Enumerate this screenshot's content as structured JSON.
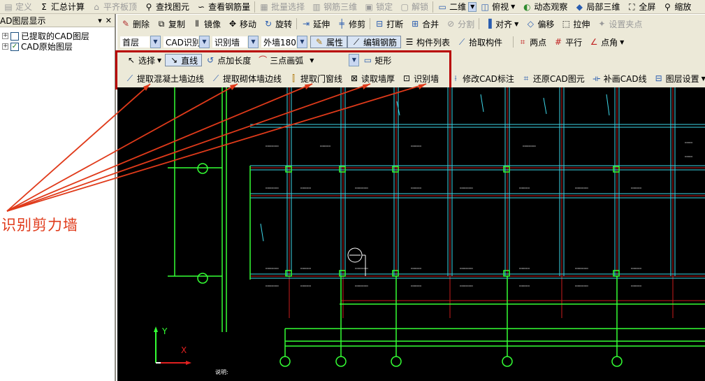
{
  "menubar": {
    "items": [
      {
        "label": "定义",
        "icon": "define-icon",
        "disabled": true
      },
      {
        "label": "汇总计算",
        "icon": "sigma-icon",
        "disabled": false
      },
      {
        "label": "平齐板顶",
        "icon": "flush-slab-icon",
        "disabled": true
      },
      {
        "label": "查找图元",
        "icon": "binoculars-icon",
        "disabled": false
      },
      {
        "label": "查看钢筋量",
        "icon": "rebar-view-icon",
        "disabled": false
      },
      {
        "label": "批量选择",
        "icon": "batch-select-icon",
        "disabled": true
      },
      {
        "label": "钢筋三维",
        "icon": "rebar-3d-icon",
        "disabled": true
      },
      {
        "label": "锁定",
        "icon": "lock-icon",
        "disabled": true
      },
      {
        "label": "解锁",
        "icon": "unlock-icon",
        "disabled": true
      },
      {
        "label": "二维",
        "icon": "2d-view-icon",
        "disabled": false
      },
      {
        "label": "俯视",
        "icon": "top-view-icon",
        "disabled": false
      },
      {
        "label": "动态观察",
        "icon": "orbit-icon",
        "disabled": false
      },
      {
        "label": "局部三维",
        "icon": "local-3d-icon",
        "disabled": false
      },
      {
        "label": "全屏",
        "icon": "fullscreen-icon",
        "disabled": false
      },
      {
        "label": "缩放",
        "icon": "zoom-icon",
        "disabled": false
      }
    ]
  },
  "leftpanel": {
    "title": "AD图层显示",
    "ctrl_pin": "▾",
    "ctrl_close": "✕",
    "layers": [
      {
        "label": "已提取的CAD图层",
        "checked": false
      },
      {
        "label": "CAD原始图层",
        "checked": true
      }
    ]
  },
  "row2": {
    "items": [
      "删除",
      "复制",
      "镜像",
      "移动",
      "旋转",
      "延伸",
      "修剪",
      "打断",
      "合并",
      "分割",
      "对齐",
      "偏移",
      "拉伸",
      "设置夹点"
    ],
    "disabled": [
      "分割",
      "设置夹点"
    ]
  },
  "row3": {
    "floor": "首层",
    "module": "CAD识别",
    "element": "识别墙",
    "wall_type": "外墙180",
    "props": "属性",
    "edit_rebar": "编辑钢筋",
    "component_list": "构件列表",
    "pick": "拾取构件",
    "two_point": "两点",
    "parallel": "平行",
    "point_angle": "点角"
  },
  "row4": {
    "select": "选择",
    "line": "直线",
    "point_length": "点加长度",
    "arc": "三点画弧",
    "rect": "矩形"
  },
  "row5": {
    "items": [
      "提取混凝土墙边线",
      "提取砌体墙边线",
      "提取门窗线",
      "读取墙厚",
      "识别墙",
      "修改CAD标注",
      "还原CAD图元",
      "补画CAD线",
      "图层设置"
    ]
  },
  "canvas": {
    "axis_y": "Y",
    "axis_x": "X",
    "note": "说明:"
  },
  "annotation": {
    "text": "识别剪力墙",
    "color": "#e03a1a"
  },
  "colors": {
    "toolbar_bg": "#ece9d8",
    "highlight_box": "#b80000",
    "cad_green": "#34ff34",
    "cad_red": "#e02020",
    "cad_cyan": "#3cd6e8"
  }
}
